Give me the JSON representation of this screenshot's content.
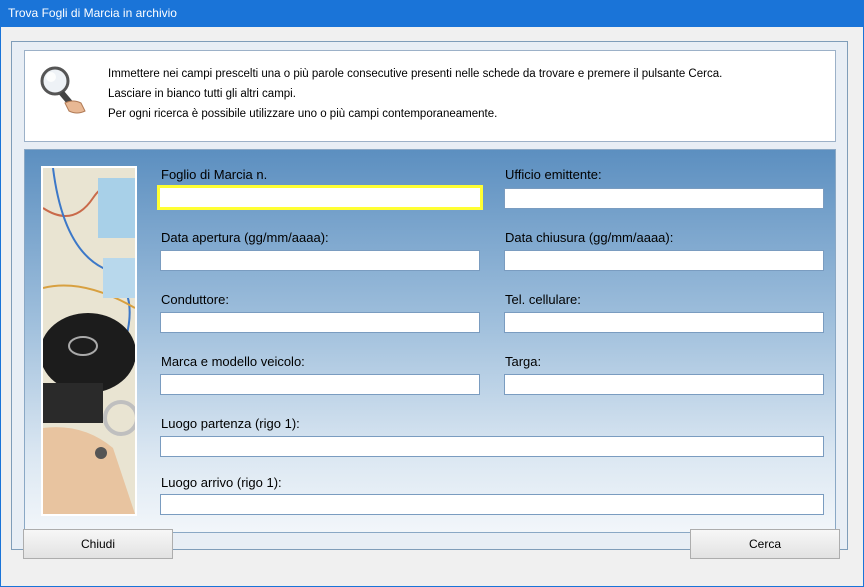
{
  "window": {
    "title": "Trova Fogli di Marcia in archivio"
  },
  "info": {
    "icon": "magnifier-hand-icon",
    "lines": [
      "Immettere nei campi prescelti una o più parole consecutive presenti nelle schede da trovare e premere il pulsante Cerca.",
      "Lasciare in bianco tutti gli altri campi.",
      "Per ogni ricerca è possibile utilizzare uno o più campi contemporaneamente."
    ]
  },
  "form": {
    "photo": "map-car-key-image",
    "fields": {
      "foglio": {
        "label": "Foglio di Marcia n.",
        "value": ""
      },
      "ufficio": {
        "label": "Ufficio emittente:",
        "value": ""
      },
      "apertura": {
        "label": "Data apertura (gg/mm/aaaa):",
        "value": ""
      },
      "chiusura": {
        "label": "Data chiusura (gg/mm/aaaa):",
        "value": ""
      },
      "conduttore": {
        "label": "Conduttore:",
        "value": ""
      },
      "cellulare": {
        "label": "Tel. cellulare:",
        "value": ""
      },
      "marca": {
        "label": "Marca e modello veicolo:",
        "value": ""
      },
      "targa": {
        "label": "Targa:",
        "value": ""
      },
      "partenza": {
        "label": "Luogo partenza (rigo 1):",
        "value": ""
      },
      "arrivo": {
        "label": "Luogo arrivo (rigo 1):",
        "value": ""
      }
    }
  },
  "buttons": {
    "close": "Chiudi",
    "search": "Cerca"
  },
  "colors": {
    "titlebar": "#1a74d8",
    "focus_border": "#ffff33"
  }
}
